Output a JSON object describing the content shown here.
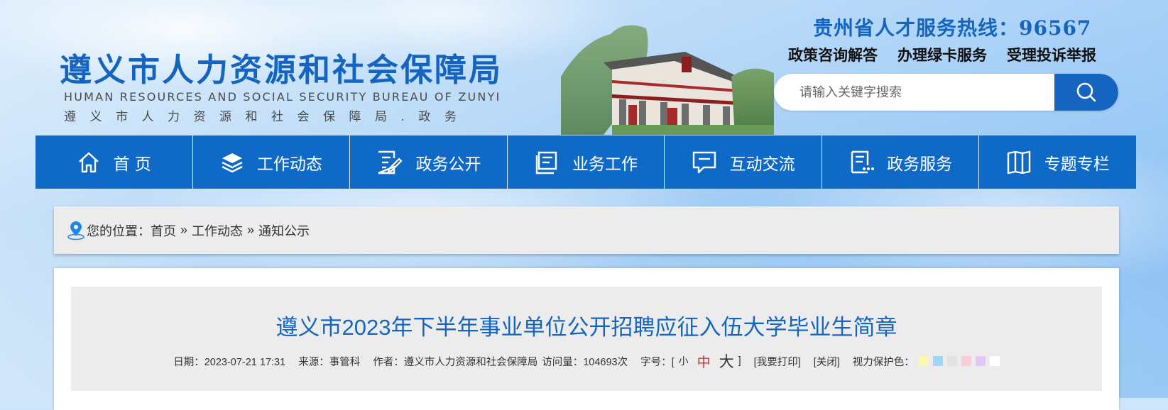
{
  "logo": {
    "cn": "遵义市人力资源和社会保障局",
    "en": "HUMAN RESOURCES AND SOCIAL SECURITY BUREAU OF ZUNYI",
    "sub": "遵义市人力资源和社会保障局.政务"
  },
  "hotline": "贵州省人才服务热线：96567",
  "quick_links": [
    "政策咨询解答",
    "办理绿卡服务",
    "受理投诉举报"
  ],
  "search": {
    "placeholder": "请输入关键字搜索"
  },
  "nav": [
    {
      "label": "首 页",
      "icon": "home-icon"
    },
    {
      "label": "工作动态",
      "icon": "layers-icon"
    },
    {
      "label": "政务公开",
      "icon": "document-edit-icon"
    },
    {
      "label": "业务工作",
      "icon": "book-icon"
    },
    {
      "label": "互动交流",
      "icon": "chat-icon"
    },
    {
      "label": "政务服务",
      "icon": "service-doc-icon"
    },
    {
      "label": "专题专栏",
      "icon": "open-book-icon"
    }
  ],
  "breadcrumb": {
    "prefix": "您的位置：",
    "items": [
      "首页",
      "工作动态",
      "通知公示"
    ],
    "separator": "»"
  },
  "article": {
    "title": "遵义市2023年下半年事业单位公开招聘应征入伍大学毕业生简章",
    "date": "日期：2023-07-21 17:31",
    "source": "来源：事管科",
    "author": "作者：遵义市人力资源和社会保障局",
    "views": "访问量：104693次",
    "font_size_label": "字号：[",
    "font_small": "小",
    "font_mid": "中",
    "font_big": "大",
    "font_close": "]",
    "print": "[我要打印]",
    "close": "[关闭]",
    "eye_care_label": "视力保护色：",
    "eye_care_colors": [
      "#fdf6b3",
      "#9fd8f3",
      "#e2e2e2",
      "#f8cfd9",
      "#e2c8f3",
      "#ffffff"
    ]
  }
}
